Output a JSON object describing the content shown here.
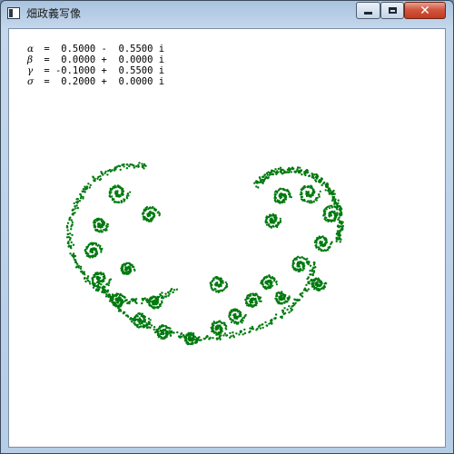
{
  "window": {
    "title": "畑政義写像"
  },
  "parameters": [
    {
      "symbol": "α",
      "text": " =  0.5000 -  0.5500 i"
    },
    {
      "symbol": "β",
      "text": " =  0.0000 +  0.0000 i"
    },
    {
      "symbol": "γ",
      "text": " = -0.1000 +  0.5500 i"
    },
    {
      "symbol": "σ",
      "text": " =  0.2000 +  0.0000 i"
    }
  ],
  "plot": {
    "color": "#007a0f",
    "background": "#ffffff"
  }
}
